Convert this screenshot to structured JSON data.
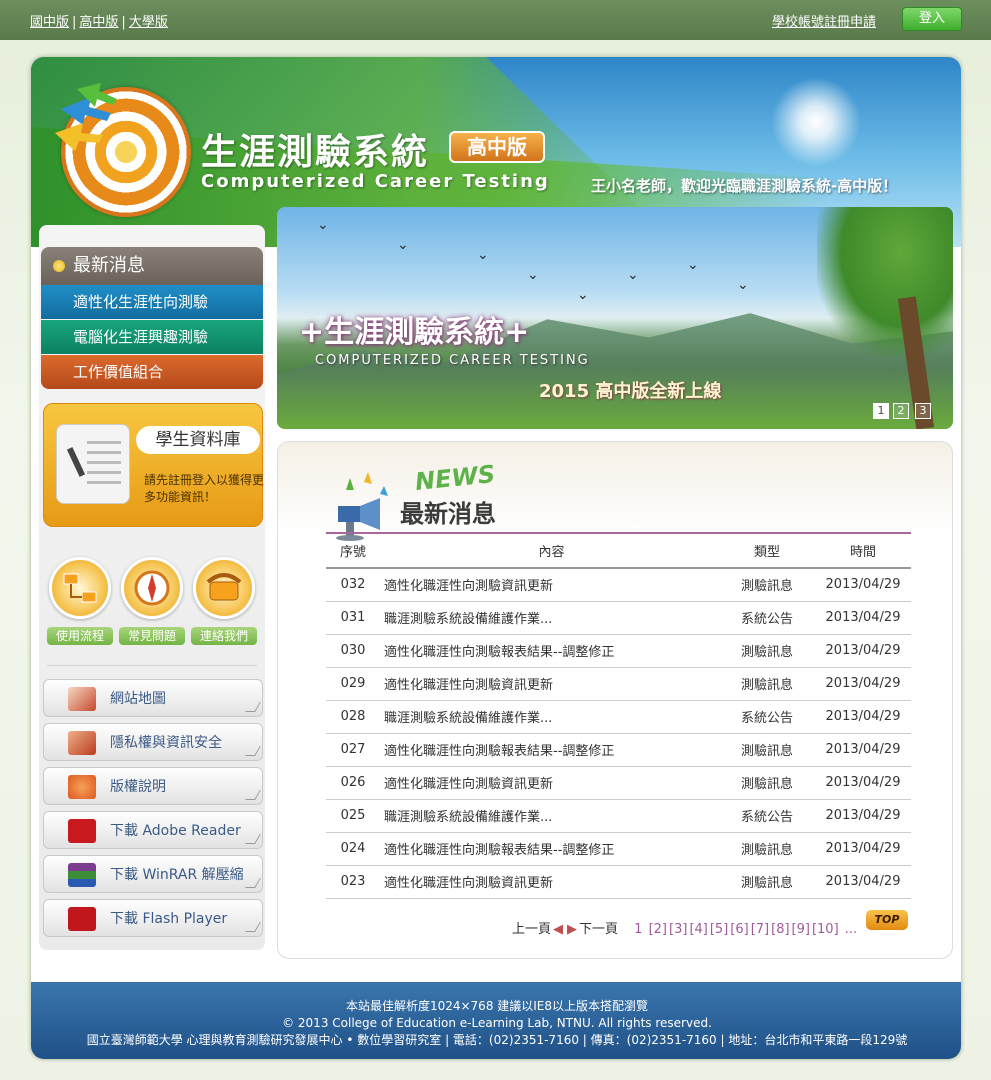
{
  "topbar": {
    "versions": [
      "國中版",
      "高中版",
      "大學版"
    ],
    "register": "學校帳號註冊申請",
    "login": "登入"
  },
  "header": {
    "title_cn": "生涯測驗系統",
    "edition": "高中版",
    "title_en": "Computerized Career Testing",
    "welcome": "王小名老師，歡迎光臨職涯測驗系統-高中版！"
  },
  "nav": {
    "head": "最新消息",
    "items": [
      "適性化生涯性向測驗",
      "電腦化生涯興趣測驗",
      "工作價值組合"
    ]
  },
  "student_db": {
    "title": "學生資料庫",
    "desc": "請先註冊登入以獲得更多功能資訊！"
  },
  "quick": [
    {
      "label": "使用流程",
      "icon": "flowchart-icon"
    },
    {
      "label": "常見問題",
      "icon": "compass-icon"
    },
    {
      "label": "連絡我們",
      "icon": "phone-icon"
    }
  ],
  "links": [
    {
      "label": "網站地圖",
      "icon": "book-icon"
    },
    {
      "label": "隱私權與資訊安全",
      "icon": "folder-icon"
    },
    {
      "label": "版權說明",
      "icon": "copyright-icon"
    },
    {
      "label": "下載 Adobe Reader",
      "icon": "adobe-reader-icon"
    },
    {
      "label": "下載 WinRAR 解壓縮",
      "icon": "winrar-icon"
    },
    {
      "label": "下載 Flash Player",
      "icon": "flash-player-icon"
    }
  ],
  "banner": {
    "title": "+生涯測驗系統+",
    "subtitle_en": "COMPUTERIZED CAREER TESTING",
    "launch": "2015 高中版全新上線",
    "pages": [
      "1",
      "2",
      "3"
    ]
  },
  "news": {
    "title_en": "NEWS",
    "title_cn": "最新消息",
    "columns": [
      "序號",
      "內容",
      "類型",
      "時間"
    ],
    "rows": [
      {
        "no": "032",
        "title": "適性化職涯性向測驗資訊更新",
        "type": "測驗訊息",
        "date": "2013/04/29"
      },
      {
        "no": "031",
        "title": "職涯測驗系統設備維護作業...",
        "type": "系統公告",
        "date": "2013/04/29"
      },
      {
        "no": "030",
        "title": "適性化職涯性向測驗報表結果--調整修正",
        "type": "測驗訊息",
        "date": "2013/04/29"
      },
      {
        "no": "029",
        "title": "適性化職涯性向測驗資訊更新",
        "type": "測驗訊息",
        "date": "2013/04/29"
      },
      {
        "no": "028",
        "title": "職涯測驗系統設備維護作業...",
        "type": "系統公告",
        "date": "2013/04/29"
      },
      {
        "no": "027",
        "title": "適性化職涯性向測驗報表結果--調整修正",
        "type": "測驗訊息",
        "date": "2013/04/29"
      },
      {
        "no": "026",
        "title": "適性化職涯性向測驗資訊更新",
        "type": "測驗訊息",
        "date": "2013/04/29"
      },
      {
        "no": "025",
        "title": "職涯測驗系統設備維護作業...",
        "type": "系統公告",
        "date": "2013/04/29"
      },
      {
        "no": "024",
        "title": "適性化職涯性向測驗報表結果--調整修正",
        "type": "測驗訊息",
        "date": "2013/04/29"
      },
      {
        "no": "023",
        "title": "適性化職涯性向測驗資訊更新",
        "type": "測驗訊息",
        "date": "2013/04/29"
      }
    ],
    "pager": {
      "prev": "上一頁",
      "next": "下一頁",
      "current": "1",
      "pages": [
        "[2]",
        "[3]",
        "[4]",
        "[5]",
        "[6]",
        "[7]",
        "[8]",
        "[9]",
        "[10]"
      ],
      "more": "...",
      "top": "TOP"
    }
  },
  "footer": {
    "line1": "本站最佳解析度1024×768 建議以IE8以上版本搭配瀏覽",
    "line2": "© 2013 College of Education e-Learning Lab, NTNU. All rights reserved.",
    "line3": "國立臺灣師範大學 心理與教育測驗研究發展中心 • 數位學習研究室 | 電話：(02)2351-7160 | 傳真：(02)2351-7160 | 地址：台北市和平東路一段129號"
  }
}
